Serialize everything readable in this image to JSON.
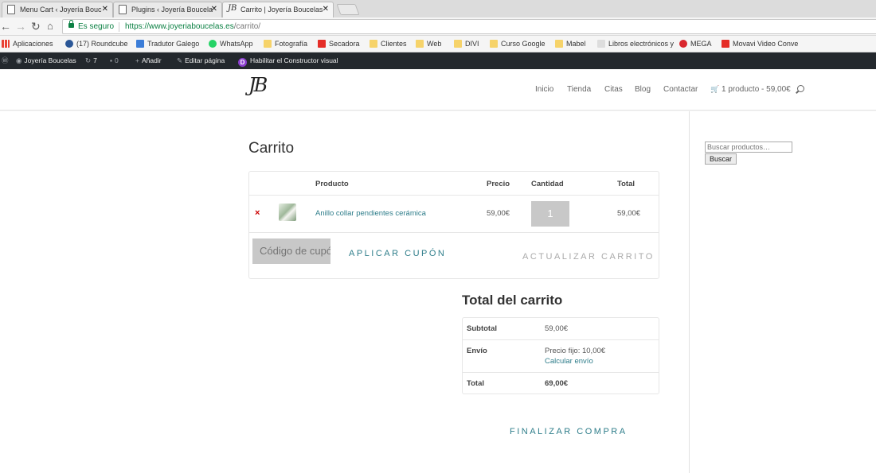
{
  "browser": {
    "tabs": [
      {
        "title": "Menu Cart ‹ Joyería Bouc"
      },
      {
        "title": "Plugins ‹ Joyería Boucela"
      },
      {
        "title": "Carrito | Joyería Boucelas"
      }
    ],
    "close_glyph": "✕",
    "secure_label": "Es seguro",
    "url_host": "https://www.joyeriaboucelas.es",
    "url_path": "/carrito/",
    "bookmarks": [
      {
        "label": "Aplicaciones",
        "icon": "apps-grid-icon"
      },
      {
        "label": "(17) Roundcube",
        "icon": "roundcube-icon"
      },
      {
        "label": "Tradutor Galego",
        "icon": "translator-icon"
      },
      {
        "label": "WhatsApp",
        "icon": "whatsapp-icon"
      },
      {
        "label": "Fotografía",
        "icon": "folder-icon"
      },
      {
        "label": "Secadora",
        "icon": "youtube-icon"
      },
      {
        "label": "Clientes",
        "icon": "folder-icon"
      },
      {
        "label": "Web",
        "icon": "folder-icon"
      },
      {
        "label": "DIVI",
        "icon": "folder-icon"
      },
      {
        "label": "Curso Google",
        "icon": "folder-icon"
      },
      {
        "label": "Mabel",
        "icon": "folder-icon"
      },
      {
        "label": "Libros electrónicos y",
        "icon": "book-icon"
      },
      {
        "label": "MEGA",
        "icon": "mega-icon"
      },
      {
        "label": "Movavi Video Conve",
        "icon": "youtube-icon"
      }
    ]
  },
  "adminbar": {
    "site_name": "Joyería Boucelas",
    "updates_count": "7",
    "comments_count": "0",
    "add_label": "Añadir",
    "edit_label": "Editar página",
    "builder_label": "Habilitar el Constructor visual"
  },
  "header": {
    "logo_text": "JB",
    "menu": [
      "Inicio",
      "Tienda",
      "Citas",
      "Blog",
      "Contactar"
    ],
    "cart_summary": "1 producto - 59,00€"
  },
  "cart": {
    "title": "Carrito",
    "columns": {
      "product": "Producto",
      "price": "Precio",
      "quantity": "Cantidad",
      "total": "Total"
    },
    "remove_glyph": "×",
    "item": {
      "name": "Anillo collar pendientes cerámica",
      "price": "59,00€",
      "quantity": "1",
      "total": "59,00€"
    },
    "coupon_placeholder": "Código de cupón",
    "apply_coupon": "APLICAR CUPÓN",
    "update_cart": "ACTUALIZAR CARRITO"
  },
  "totals": {
    "title": "Total del carrito",
    "subtotal_label": "Subtotal",
    "subtotal_value": "59,00€",
    "shipping_label": "Envío",
    "shipping_value": "Precio fijo: 10,00€",
    "calc_shipping": "Calcular envío",
    "total_label": "Total",
    "total_value": "69,00€",
    "checkout": "FINALIZAR COMPRA"
  },
  "widget": {
    "search_placeholder": "Buscar productos…",
    "search_button": "Buscar"
  },
  "colors": {
    "accent": "#2e7d8a",
    "adminbar_bg": "#23282d",
    "remove": "#cc0000"
  }
}
